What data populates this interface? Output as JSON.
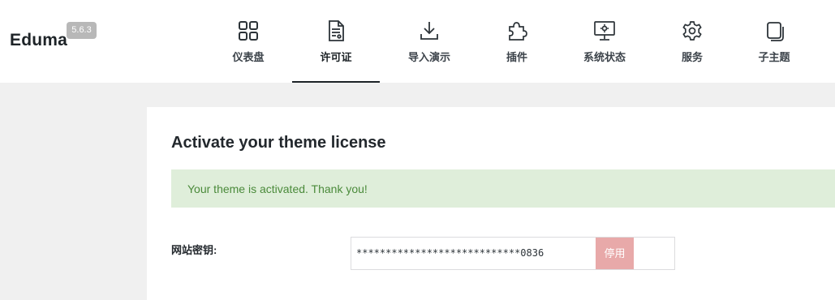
{
  "brand": {
    "name": "Eduma",
    "version": "5.6.3"
  },
  "nav": {
    "items": [
      {
        "label": "仪表盘",
        "icon": "dashboard-grid-icon"
      },
      {
        "label": "许可证",
        "icon": "license-document-icon",
        "active": true
      },
      {
        "label": "导入演示",
        "icon": "download-icon"
      },
      {
        "label": "插件",
        "icon": "puzzle-piece-icon"
      },
      {
        "label": "系统状态",
        "icon": "monitor-settings-icon"
      },
      {
        "label": "服务",
        "icon": "gear-icon"
      },
      {
        "label": "子主题",
        "icon": "copy-pages-icon"
      }
    ]
  },
  "panel": {
    "title": "Activate your theme license",
    "notice": "Your theme is activated. Thank you!",
    "field_label": "网站密钥:",
    "key_value": "****************************0836",
    "deactivate_label": "停用"
  },
  "colors": {
    "notice_bg": "#dfeeda",
    "notice_text": "#4a8a3a",
    "deactivate_bg": "#e8a9a9",
    "version_badge_bg": "#b8b8b8"
  }
}
